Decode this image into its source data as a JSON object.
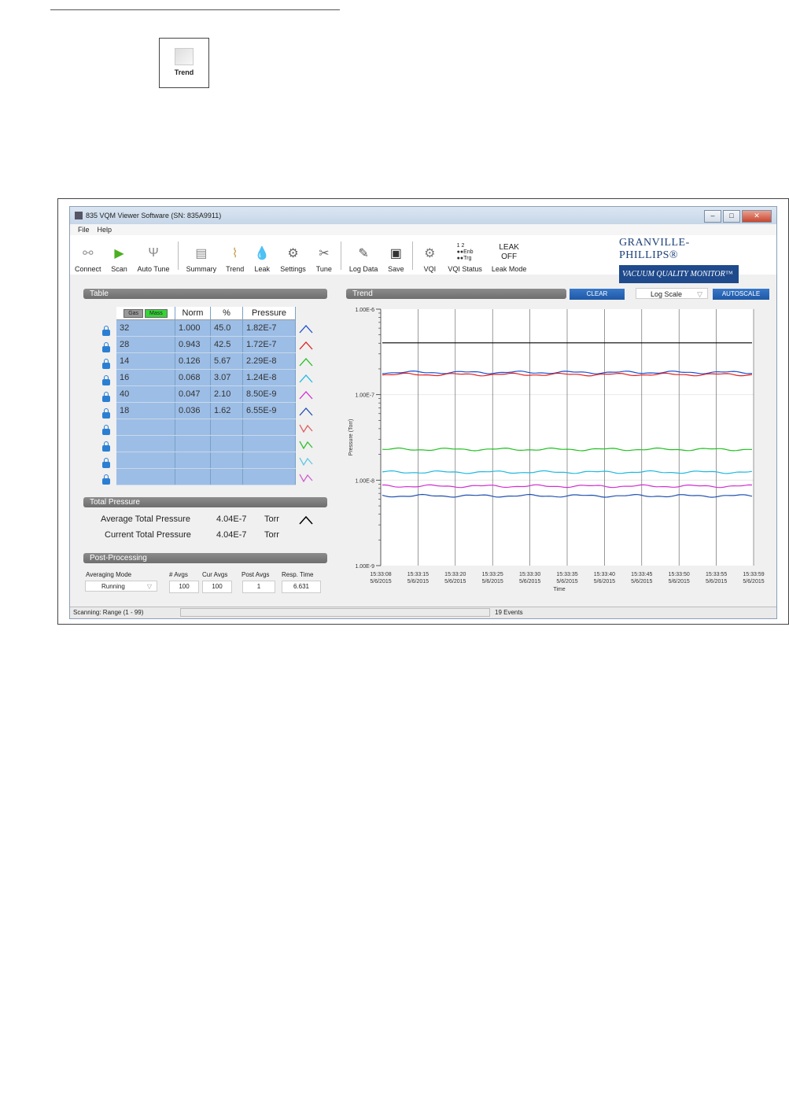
{
  "callout": {
    "label": "Trend"
  },
  "window": {
    "title": "835 VQM Viewer Software (SN: 835A9911)",
    "menu": [
      "File",
      "Help"
    ],
    "toolbar": [
      {
        "label": "Connect",
        "icon": "connect-icon"
      },
      {
        "label": "Scan",
        "icon": "play-icon"
      },
      {
        "label": "Auto Tune",
        "icon": "tuning-fork-icon"
      },
      {
        "label": "Summary",
        "icon": "summary-chart-icon"
      },
      {
        "label": "Trend",
        "icon": "trend-icon"
      },
      {
        "label": "Leak",
        "icon": "drop-icon"
      },
      {
        "label": "Settings",
        "icon": "gear-icon"
      },
      {
        "label": "Tune",
        "icon": "tools-icon"
      },
      {
        "label": "Log Data",
        "icon": "log-icon"
      },
      {
        "label": "Save",
        "icon": "save-icon"
      },
      {
        "label": "VQI",
        "icon": "gear-icon"
      },
      {
        "label": "VQI Status",
        "icon": "status-leds-icon"
      },
      {
        "label": "Leak Mode",
        "icon": "leak-mode-icon"
      }
    ],
    "vqi_status": {
      "top": "1  2",
      "enb": "Enb",
      "trg": "Trg"
    },
    "leak_mode": {
      "line1": "LEAK",
      "line2": "OFF"
    },
    "brand": {
      "name": "GRANVILLE-PHILLIPS®",
      "subtitle": "VACUUM QUALITY MONITOR™"
    }
  },
  "table": {
    "header": "Table",
    "gas_label": "Gas",
    "mass_label": "Mass",
    "columns": [
      "Norm",
      "%",
      "Pressure"
    ],
    "rows": [
      {
        "mass": "32",
        "norm": "1.000",
        "pct": "45.0",
        "pressure": "1.82E-7",
        "color": "#1f4fd0"
      },
      {
        "mass": "28",
        "norm": "0.943",
        "pct": "42.5",
        "pressure": "1.72E-7",
        "color": "#e02020"
      },
      {
        "mass": "14",
        "norm": "0.126",
        "pct": "5.67",
        "pressure": "2.29E-8",
        "color": "#20c020"
      },
      {
        "mass": "16",
        "norm": "0.068",
        "pct": "3.07",
        "pressure": "1.24E-8",
        "color": "#20b8e0"
      },
      {
        "mass": "40",
        "norm": "0.047",
        "pct": "2.10",
        "pressure": "8.50E-9",
        "color": "#d030d0"
      },
      {
        "mass": "18",
        "norm": "0.036",
        "pct": "1.62",
        "pressure": "6.55E-9",
        "color": "#2050b0"
      },
      {
        "mass": "",
        "norm": "",
        "pct": "",
        "pressure": "",
        "color": "#e06060"
      },
      {
        "mass": "",
        "norm": "",
        "pct": "",
        "pressure": "",
        "color": "#30c030"
      },
      {
        "mass": "",
        "norm": "",
        "pct": "",
        "pressure": "",
        "color": "#60c8e8"
      },
      {
        "mass": "",
        "norm": "",
        "pct": "",
        "pressure": "",
        "color": "#d060d0"
      }
    ]
  },
  "total_pressure": {
    "header": "Total Pressure",
    "avg_label": "Average Total Pressure",
    "avg_value": "4.04E-7",
    "cur_label": "Current Total Pressure",
    "cur_value": "4.04E-7",
    "unit": "Torr"
  },
  "post_processing": {
    "header": "Post-Processing",
    "mode_label": "Averaging Mode",
    "mode_value": "Running",
    "avgs_label": "# Avgs",
    "avgs_value": "100",
    "cur_avgs_label": "Cur Avgs",
    "cur_avgs_value": "100",
    "post_avgs_label": "Post Avgs",
    "post_avgs_value": "1",
    "resp_label": "Resp. Time",
    "resp_value": "6.631"
  },
  "trend": {
    "header": "Trend",
    "clear_label": "CLEAR",
    "scale_value": "Log Scale",
    "autoscale_label": "AUTOSCALE"
  },
  "status": {
    "left": "Scanning: Range (1 - 99)",
    "right": "19 Events"
  },
  "chart_data": {
    "type": "line",
    "ylabel": "Pressure (Torr)",
    "xlabel": "Time",
    "yscale": "log",
    "ylim": [
      1e-09,
      1e-06
    ],
    "ytick_labels": [
      "1.00E-6",
      "1.00E-7",
      "1.00E-8",
      "1.00E-9"
    ],
    "x_ticks": [
      [
        "15:33:08",
        "5/6/2015"
      ],
      [
        "15:33:15",
        "5/6/2015"
      ],
      [
        "15:33:20",
        "5/6/2015"
      ],
      [
        "15:33:25",
        "5/6/2015"
      ],
      [
        "15:33:30",
        "5/6/2015"
      ],
      [
        "15:33:35",
        "5/6/2015"
      ],
      [
        "15:33:40",
        "5/6/2015"
      ],
      [
        "15:33:45",
        "5/6/2015"
      ],
      [
        "15:33:50",
        "5/6/2015"
      ],
      [
        "15:33:55",
        "5/6/2015"
      ],
      [
        "15:33:59",
        "5/6/2015"
      ]
    ],
    "series": [
      {
        "color": "#000000",
        "value": 4.04e-07
      },
      {
        "color": "#1f4fd0",
        "value": 1.82e-07
      },
      {
        "color": "#e02020",
        "value": 1.72e-07
      },
      {
        "color": "#20c020",
        "value": 2.29e-08
      },
      {
        "color": "#20b8e0",
        "value": 1.24e-08
      },
      {
        "color": "#d030d0",
        "value": 8.5e-09
      },
      {
        "color": "#2050b0",
        "value": 6.55e-09
      }
    ]
  }
}
